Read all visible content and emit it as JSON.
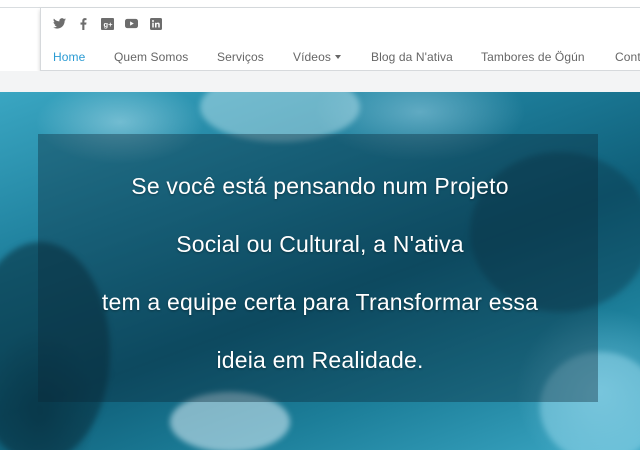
{
  "social": [
    {
      "icon": "twitter-icon"
    },
    {
      "icon": "facebook-icon"
    },
    {
      "icon": "google-plus-icon"
    },
    {
      "icon": "youtube-icon"
    },
    {
      "icon": "linkedin-icon"
    }
  ],
  "nav": {
    "items": [
      {
        "label": "Home",
        "active": true
      },
      {
        "label": "Quem Somos"
      },
      {
        "label": "Serviços"
      },
      {
        "label": "Vídeos",
        "dropdown": true
      },
      {
        "label": "Blog da N'ativa"
      },
      {
        "label": "Tambores de Ögún"
      },
      {
        "label": "Conta"
      }
    ]
  },
  "hero": {
    "lines": [
      "Se você está pensando num Projeto",
      "Social ou Cultural, a N'ativa",
      "tem a equipe certa para Transformar essa",
      "ideia em Realidade."
    ]
  },
  "colors": {
    "accent": "#2b9bd3",
    "nav_text": "#666666",
    "hero_base": "#1e7f9c"
  }
}
